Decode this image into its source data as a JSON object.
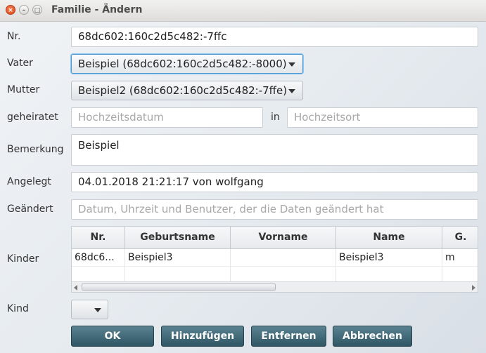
{
  "window": {
    "title": "Familie - Ändern",
    "close_glyph": "×",
    "min_glyph": "–",
    "max_glyph": "□"
  },
  "labels": {
    "nr": "Nr.",
    "vater": "Vater",
    "mutter": "Mutter",
    "geheiratet": "geheiratet",
    "in": "in",
    "bemerkung": "Bemerkung",
    "angelegt": "Angelegt",
    "geaendert": "Geändert",
    "kinder": "Kinder",
    "kind": "Kind"
  },
  "fields": {
    "nr": "68dc602:160c2d5c482:-7ffc",
    "vater": "Beispiel (68dc602:160c2d5c482:-8000)",
    "mutter": "Beispiel2 (68dc602:160c2d5c482:-7ffe)",
    "hochzeitsdatum_placeholder": "Hochzeitsdatum",
    "hochzeitsort_placeholder": "Hochzeitsort",
    "bemerkung": "Beispiel",
    "angelegt": "04.01.2018 21:21:17 von wolfgang",
    "geaendert_placeholder": "Datum, Uhrzeit und Benutzer, der die Daten geändert hat",
    "kind": ""
  },
  "kinder_table": {
    "columns": [
      "Nr.",
      "Geburtsname",
      "Vorname",
      "Name",
      "G."
    ],
    "rows": [
      [
        "68dc6...",
        "Beispiel3",
        "",
        "Beispiel3",
        "m"
      ]
    ]
  },
  "buttons": {
    "ok": "OK",
    "hinzufuegen": "Hinzufügen",
    "entfernen": "Entfernen",
    "abbrechen": "Abbrechen"
  },
  "icons": {
    "dropdown": "chevron-down-icon",
    "scroll_left": "arrow-left-icon",
    "scroll_right": "arrow-right-icon"
  }
}
